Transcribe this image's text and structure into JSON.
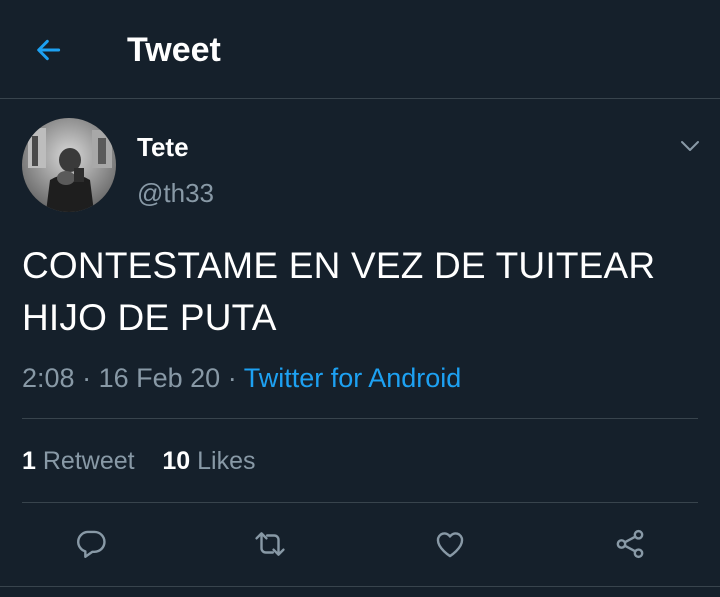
{
  "header": {
    "back_icon": "arrow-left-icon",
    "title": "Tweet"
  },
  "tweet": {
    "author": {
      "display_name": "Tete",
      "handle": "@th33"
    },
    "text_lines": [
      "CONTESTAME EN VEZ DE TUITEAR",
      "HIJO DE PUTA"
    ],
    "time": "2:08",
    "separator": "·",
    "date": "16 Feb 20",
    "source": "Twitter for Android",
    "stats": {
      "retweets_count": "1",
      "retweets_label": "Retweet",
      "likes_count": "10",
      "likes_label": "Likes"
    }
  },
  "actions": [
    "reply-icon",
    "retweet-icon",
    "like-icon",
    "share-icon"
  ],
  "colors": {
    "background": "#15202b",
    "accent": "#1da1f2",
    "secondary_text": "#8899a6",
    "divider": "#38444d"
  }
}
